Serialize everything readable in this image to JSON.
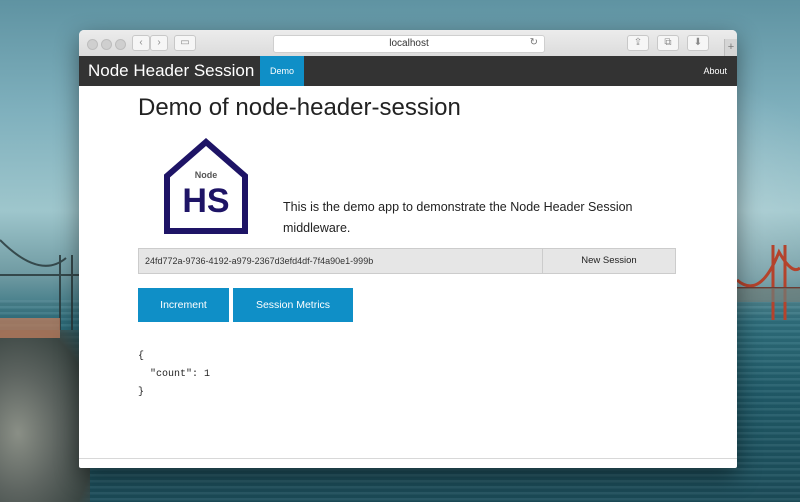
{
  "browser": {
    "url": "localhost",
    "back_glyph": "‹",
    "forward_glyph": "›",
    "sidebar_glyph": "▭",
    "reload_glyph": "↻",
    "share_glyph": "⇪",
    "tabs_glyph": "⧉",
    "download_glyph": "⬇",
    "newtab_glyph": "+"
  },
  "navbar": {
    "brand": "Node Header Session",
    "items": [
      {
        "label": "Demo",
        "active": true
      },
      {
        "label": "About",
        "active": false
      }
    ]
  },
  "page": {
    "title": "Demo of node-header-session",
    "logo": {
      "small_text": "Node",
      "big_text": "HS",
      "color": "#1e1466"
    },
    "intro": "This is the demo app to demonstrate the Node Header Session middleware."
  },
  "session": {
    "id": "24fd772a-9736-4192-a979-2367d3efd4df-7f4a90e1-999b",
    "new_session_label": "New Session"
  },
  "actions": {
    "increment_label": "Increment",
    "metrics_label": "Session Metrics"
  },
  "output": {
    "json_text": "{\n  \"count\": 1\n}"
  },
  "colors": {
    "accent": "#0f8fc7",
    "navbar": "#333333"
  }
}
